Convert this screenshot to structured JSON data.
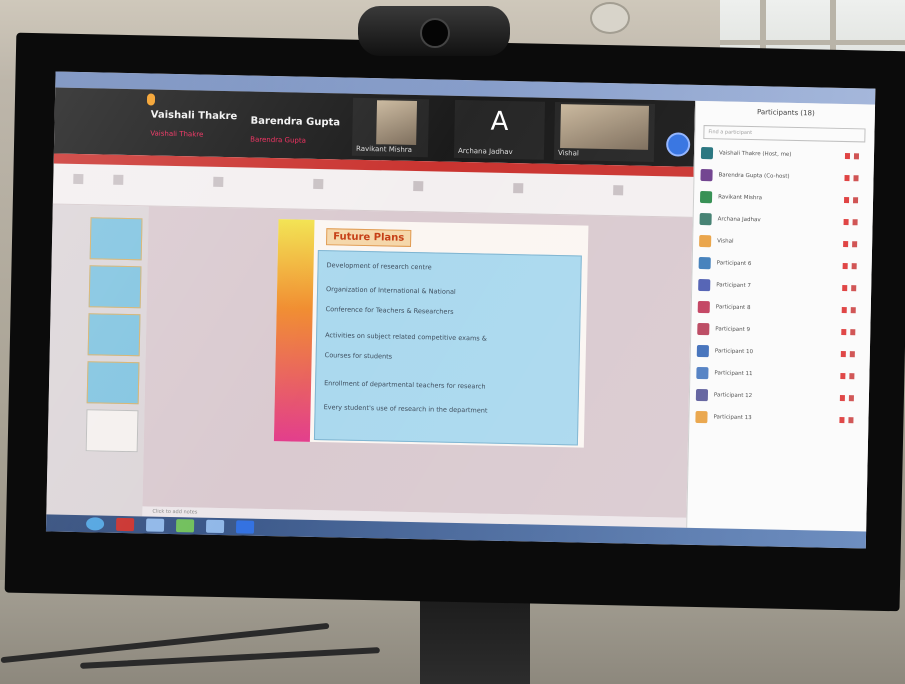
{
  "video_strip": {
    "speaker_name": "Vaishali Thakre",
    "speaker_sub": "Vaishali Thakre",
    "second_name": "Barendra Gupta",
    "second_sub": "Barendra Gupta",
    "tile_names": [
      "Ravikant Mishra",
      "Archana Jadhav",
      "Vishal"
    ],
    "avatar_letter": "A"
  },
  "slide": {
    "title": "Future Plans",
    "bullets": [
      "Development of research centre",
      "Organization of International & National",
      "Conference for Teachers & Researchers",
      "Activities on subject related competitive exams &",
      "Courses for students",
      "Enrollment of departmental teachers for research",
      "Every student's use of research in the department"
    ],
    "notes_placeholder": "Click to add notes"
  },
  "participants": {
    "title": "Participants (18)",
    "search_placeholder": "Find a participant",
    "items": [
      {
        "name": "Vaishali Thakre (Host, me)",
        "color": "#1f6f7a"
      },
      {
        "name": "Barendra Gupta (Co-host)",
        "color": "#6a3a8a"
      },
      {
        "name": "Ravikant Mishra",
        "color": "#2a8a4a"
      },
      {
        "name": "Archana Jadhav",
        "color": "#3a7a6a"
      },
      {
        "name": "Vishal",
        "color": "#e8a040"
      },
      {
        "name": "Participant 6",
        "color": "#3a7ab8"
      },
      {
        "name": "Participant 7",
        "color": "#4a5ab0"
      },
      {
        "name": "Participant 8",
        "color": "#c03a5a"
      },
      {
        "name": "Participant 9",
        "color": "#b8405a"
      },
      {
        "name": "Participant 10",
        "color": "#3a6ab8"
      },
      {
        "name": "Participant 11",
        "color": "#4a7ac0"
      },
      {
        "name": "Participant 12",
        "color": "#5a5a9a"
      },
      {
        "name": "Participant 13",
        "color": "#e8a040"
      }
    ]
  },
  "colors": {
    "ribbon_accent": "#c9302c",
    "slide_box": "#a9d8ee",
    "video_bg": "#161616"
  }
}
